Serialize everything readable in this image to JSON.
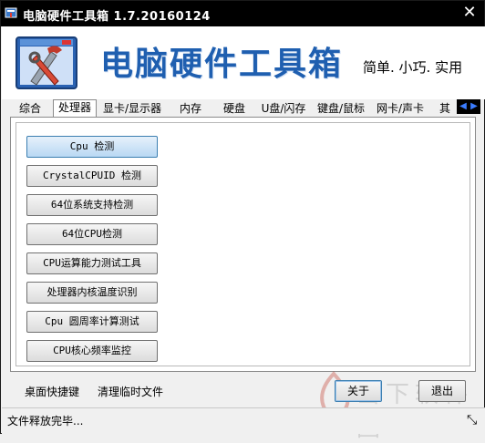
{
  "window": {
    "title": "电脑硬件工具箱 1.7.20160124",
    "close_symbol": "✕"
  },
  "banner": {
    "title": "电脑硬件工具箱",
    "slogan": "简单. 小巧. 实用"
  },
  "tabs": [
    {
      "label": "综合"
    },
    {
      "label": "处理器",
      "active": true
    },
    {
      "label": "显卡/显示器"
    },
    {
      "label": "内存"
    },
    {
      "label": "硬盘"
    },
    {
      "label": "U盘/闪存"
    },
    {
      "label": "键盘/鼠标"
    },
    {
      "label": "网卡/声卡"
    },
    {
      "label": "其"
    }
  ],
  "tab_nav": {
    "prev": "◀",
    "next": "▶"
  },
  "functions": [
    {
      "label": "Cpu 检测",
      "selected": true
    },
    {
      "label": "CrystalCPUID 检测"
    },
    {
      "label": "64位系统支持检测"
    },
    {
      "label": "64位CPU检测"
    },
    {
      "label": "CPU运算能力测试工具"
    },
    {
      "label": "处理器内核温度识别"
    },
    {
      "label": "Cpu 圆周率计算测试"
    },
    {
      "label": "CPU核心频率监控"
    }
  ],
  "bottom": {
    "desktop_shortcut": "桌面快捷键",
    "clean_temp": "清理临时文件",
    "about": "关于",
    "exit": "退出"
  },
  "watermark": {
    "text": "当下软件园"
  },
  "status": {
    "text": "文件释放完毕..."
  },
  "icons": {
    "app": "toolbox-icon",
    "logo": "window-tools-icon",
    "grip": "resize-grip-icon"
  },
  "colors": {
    "title_bar": "#000000",
    "banner_title": "#1f5fb0",
    "selected_button": "#b9d8f3"
  }
}
